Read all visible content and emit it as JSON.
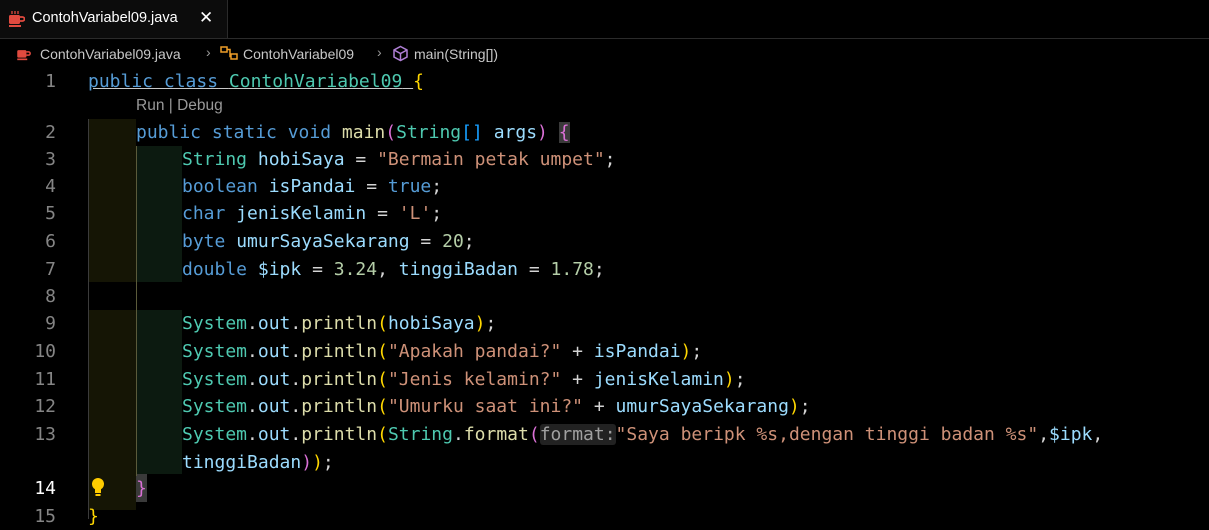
{
  "tab": {
    "label": "ContohVariabel09.java",
    "close": "✕",
    "icon": "java-cup-icon"
  },
  "breadcrumb": {
    "file": "ContohVariabel09.java",
    "class": "ContohVariabel09",
    "method": "main(String[])"
  },
  "codelens": "Run | Debug",
  "line_numbers": [
    "1",
    "2",
    "3",
    "4",
    "5",
    "6",
    "7",
    "8",
    "9",
    "10",
    "11",
    "12",
    "13",
    "14",
    "15"
  ],
  "code": {
    "l1": {
      "kw": "public class",
      "name": "ContohVariabel09",
      "brace": "{"
    },
    "l2": {
      "kw": "public static void",
      "fn": "main",
      "ty": "String",
      "arr": "[]",
      "arg": "args"
    },
    "l3": {
      "ty": "String",
      "var": "hobiSaya",
      "str": "\"Bermain petak umpet\""
    },
    "l4": {
      "kw": "boolean",
      "var": "isPandai",
      "val": "true"
    },
    "l5": {
      "kw": "char",
      "var": "jenisKelamin",
      "str": "'L'"
    },
    "l6": {
      "kw": "byte",
      "var": "umurSayaSekarang",
      "num": "20"
    },
    "l7": {
      "kw": "double",
      "var1": "$ipk",
      "num1": "3.24",
      "var2": "tinggiBadan",
      "num2": "1.78"
    },
    "sys": "System",
    "out": "out",
    "println": "println",
    "l9": {
      "arg": "hobiSaya"
    },
    "l10": {
      "str": "\"Apakah pandai?\"",
      "var": "isPandai"
    },
    "l11": {
      "str": "\"Jenis kelamin?\"",
      "var": "jenisKelamin"
    },
    "l12": {
      "str": "\"Umurku saat ini?\"",
      "var": "umurSayaSekarang"
    },
    "l13": {
      "ty": "String",
      "fn": "format",
      "hint": "format:",
      "str": "\"Saya beripk %s,dengan tinggi badan %s\"",
      "var": "$ipk"
    },
    "l13b": {
      "var": "tinggiBadan"
    },
    "l14": {
      "brace": "}"
    },
    "l15": {
      "brace": "}"
    }
  },
  "colors": {
    "keyword": "#569cd6",
    "type": "#4ec9b0",
    "function": "#dcdcaa",
    "variable": "#9cdcfe",
    "string": "#ce9178",
    "number": "#b5cea8"
  }
}
